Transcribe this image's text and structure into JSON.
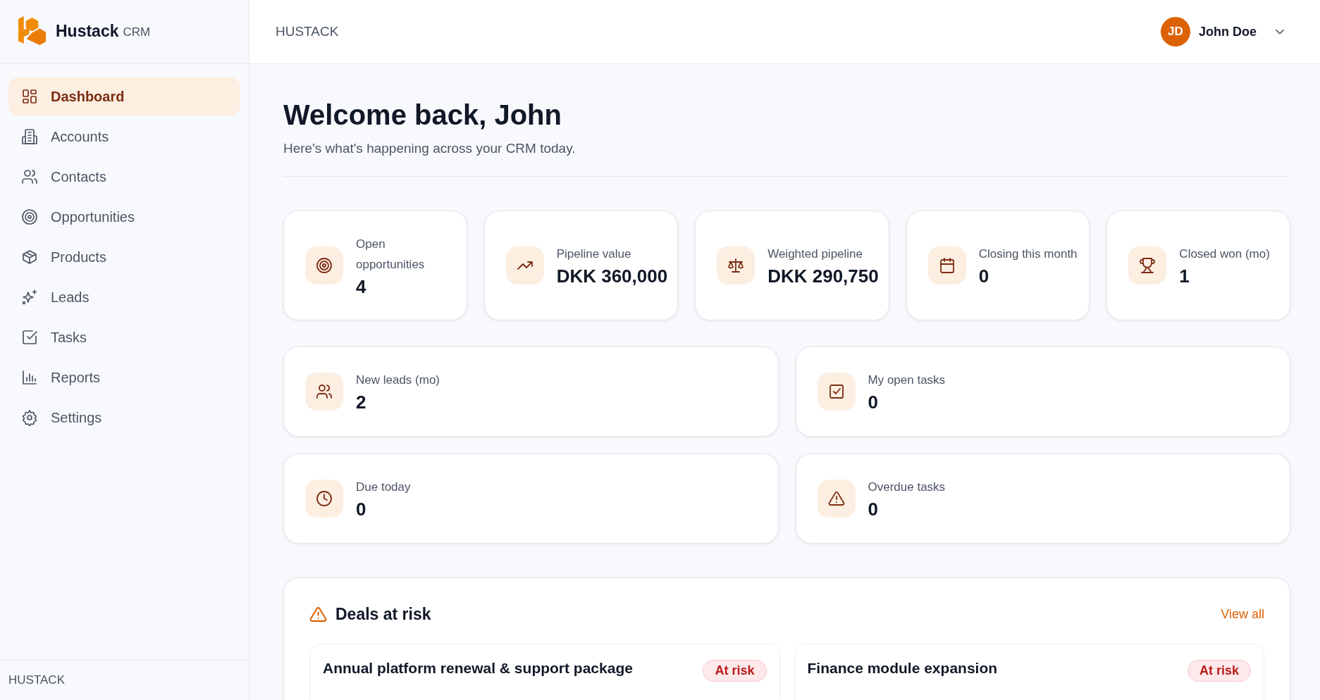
{
  "brand": {
    "name": "Hustack",
    "suffix": "CRM"
  },
  "sidebar": {
    "items": [
      {
        "label": "Dashboard",
        "selected": true
      },
      {
        "label": "Accounts",
        "selected": false
      },
      {
        "label": "Contacts",
        "selected": false
      },
      {
        "label": "Opportunities",
        "selected": false
      },
      {
        "label": "Products",
        "selected": false
      },
      {
        "label": "Leads",
        "selected": false
      },
      {
        "label": "Tasks",
        "selected": false
      },
      {
        "label": "Reports",
        "selected": false
      },
      {
        "label": "Settings",
        "selected": false
      }
    ],
    "footer": "HUSTACK"
  },
  "header": {
    "title": "HUSTACK",
    "user": {
      "initials": "JD",
      "name": "John Doe"
    }
  },
  "welcome": {
    "title": "Welcome back, John",
    "subtitle": "Here's what's happening across your CRM today."
  },
  "stats": [
    {
      "label": "Open opportunities",
      "value": "4"
    },
    {
      "label": "Pipeline value",
      "value": "DKK 360,000"
    },
    {
      "label": "Weighted pipeline",
      "value": "DKK 290,750"
    },
    {
      "label": "Closing this month",
      "value": "0"
    },
    {
      "label": "Closed won (mo)",
      "value": "1"
    }
  ],
  "task_stats": [
    {
      "label": "New leads (mo)",
      "value": "2"
    },
    {
      "label": "My open tasks",
      "value": "0"
    },
    {
      "label": "Due today",
      "value": "0"
    },
    {
      "label": "Overdue tasks",
      "value": "0"
    }
  ],
  "deals_at_risk": {
    "title": "Deals at risk",
    "link": "View all",
    "deals": [
      {
        "title": "Annual platform renewal & support package",
        "badge": "At risk"
      },
      {
        "title": "Finance module expansion",
        "badge": "At risk"
      }
    ]
  }
}
